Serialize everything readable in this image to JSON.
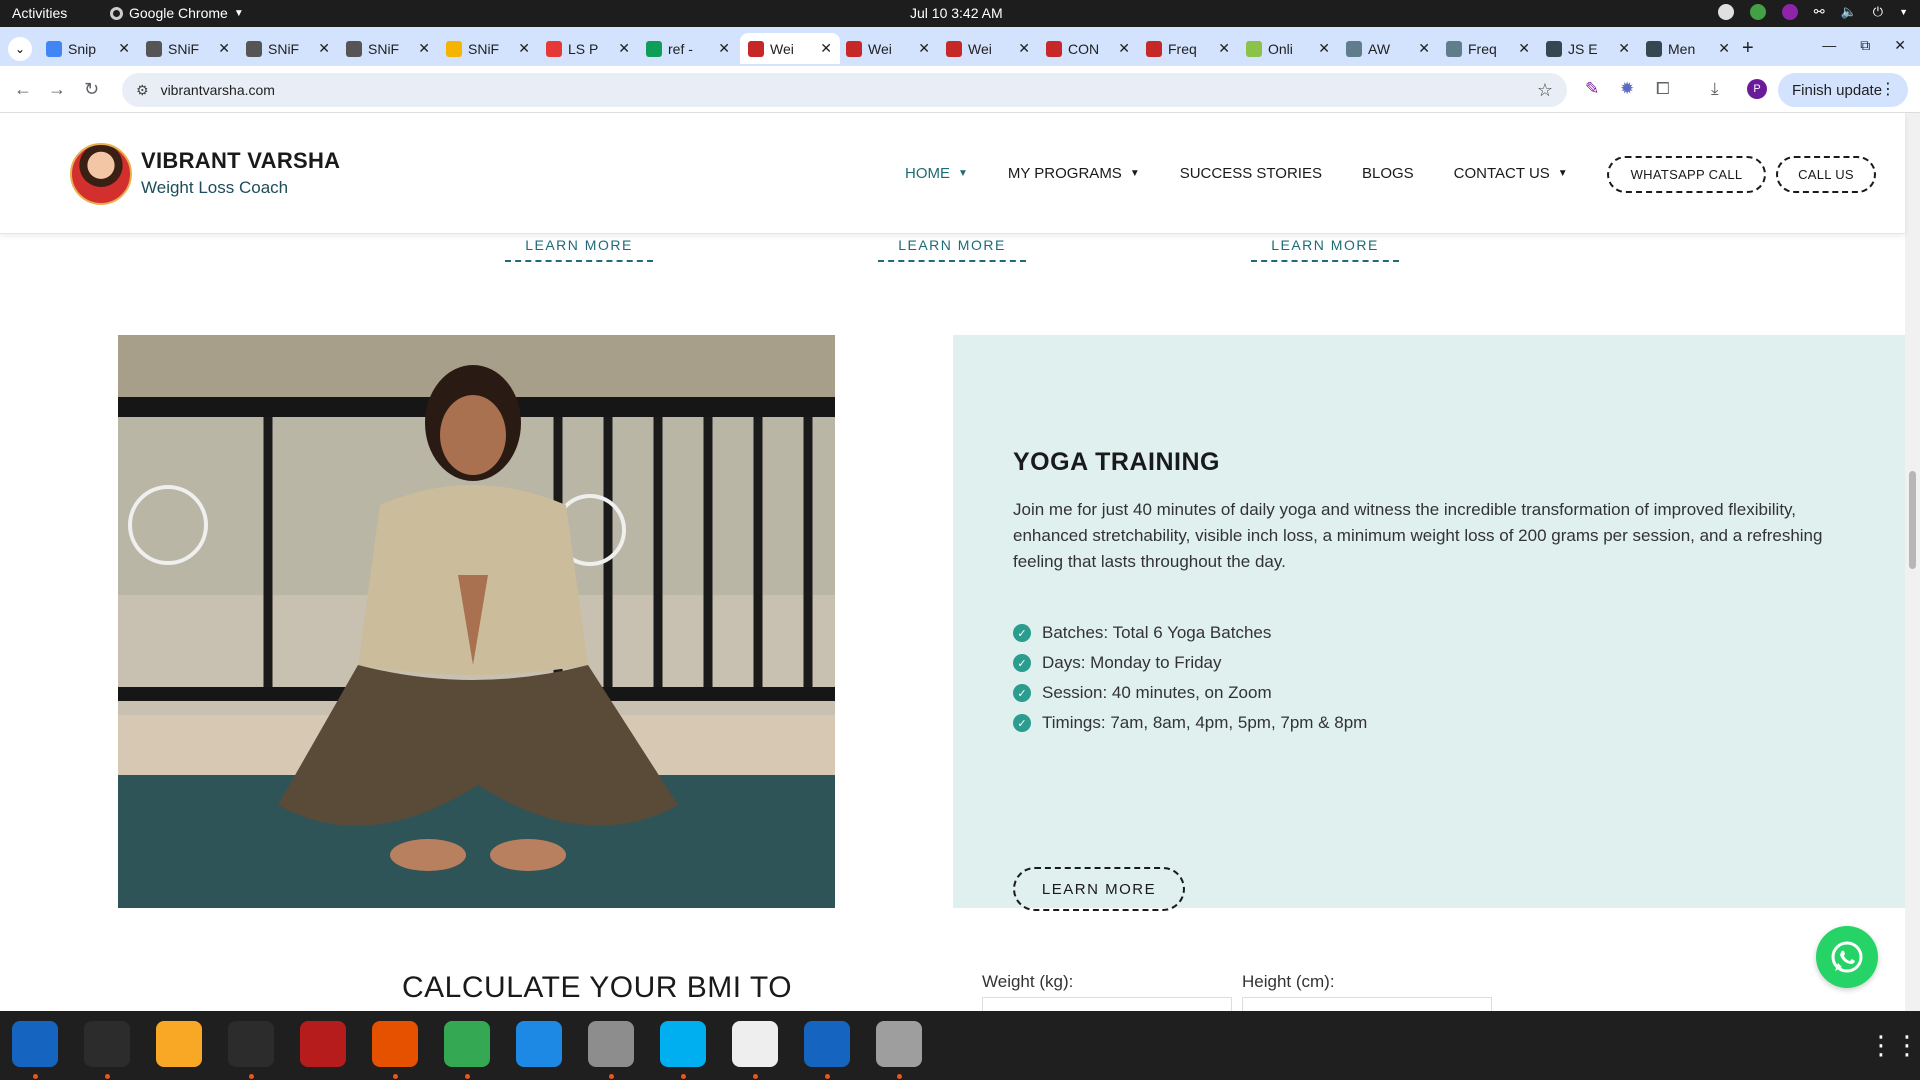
{
  "system": {
    "activities": "Activities",
    "app_name": "Google Chrome",
    "clock": "Jul 10  3:42 AM"
  },
  "tabs": [
    {
      "label": "Snip",
      "icon": "docs-icon",
      "color": "#4285f4"
    },
    {
      "label": "SNiF",
      "icon": "snif-icon",
      "color": "#555555"
    },
    {
      "label": "SNiF",
      "icon": "snif-icon",
      "color": "#555555"
    },
    {
      "label": "SNiF",
      "icon": "snif-icon",
      "color": "#555555"
    },
    {
      "label": "SNiF",
      "icon": "chrome-icon",
      "color": "#f4b400"
    },
    {
      "label": "LS P",
      "icon": "ls-icon",
      "color": "#e53935"
    },
    {
      "label": "ref -",
      "icon": "sheets-icon",
      "color": "#0f9d58"
    },
    {
      "label": "Wei",
      "icon": "vv-icon",
      "color": "#c62828"
    },
    {
      "label": "Wei",
      "icon": "vv-icon",
      "color": "#c62828"
    },
    {
      "label": "Wei",
      "icon": "vv-icon",
      "color": "#c62828"
    },
    {
      "label": "CON",
      "icon": "vv-icon",
      "color": "#c62828"
    },
    {
      "label": "Freq",
      "icon": "vv-icon",
      "color": "#c62828"
    },
    {
      "label": "Onli",
      "icon": "image-icon",
      "color": "#8bc34a"
    },
    {
      "label": "AW",
      "icon": "aw-icon",
      "color": "#607d8b"
    },
    {
      "label": "Freq",
      "icon": "freq-icon",
      "color": "#607d8b"
    },
    {
      "label": "JS E",
      "icon": "shield-icon",
      "color": "#37474f"
    },
    {
      "label": "Men",
      "icon": "shield-icon",
      "color": "#37474f"
    }
  ],
  "browser": {
    "url": "vibrantvarsha.com",
    "finish_update": "Finish update",
    "profile_initial": "P"
  },
  "site": {
    "brand_name": "VIBRANT VARSHA",
    "brand_tagline": "Weight Loss Coach",
    "nav": [
      {
        "label": "HOME",
        "has_caret": true
      },
      {
        "label": "MY PROGRAMS",
        "has_caret": true
      },
      {
        "label": "SUCCESS STORIES",
        "has_caret": false
      },
      {
        "label": "BLOGS",
        "has_caret": false
      },
      {
        "label": "CONTACT US",
        "has_caret": true
      }
    ],
    "whatsapp_call": "WHATSAPP CALL",
    "call_us": "CALL US",
    "learn_more": "LEARN MORE"
  },
  "yoga": {
    "title": "YOGA TRAINING",
    "description": "Join me for just 40 minutes of daily yoga and witness the incredible transformation of improved flexibility, enhanced stretchability, visible inch loss, a minimum weight loss of 200 grams per session, and a refreshing feeling that lasts throughout the day.",
    "features": [
      "Batches: Total 6 Yoga Batches",
      "Days: Monday to Friday",
      "Session: 40 minutes, on Zoom",
      "Timings: 7am, 8am, 4pm, 5pm, 7pm & 8pm"
    ],
    "button": "LEARN MORE"
  },
  "bmi": {
    "title": "CALCULATE YOUR BMI TO",
    "weight_label": "Weight (kg):",
    "height_label": "Height (cm):"
  },
  "dock": [
    {
      "name": "thunderbird-icon",
      "color": "#1565c0"
    },
    {
      "name": "terminal-icon",
      "color": "#2c2c2c"
    },
    {
      "name": "notes-icon",
      "color": "#f9a825"
    },
    {
      "name": "system-monitor-icon",
      "color": "#2c2c2c"
    },
    {
      "name": "filezilla-icon",
      "color": "#b71c1c"
    },
    {
      "name": "firefox-icon",
      "color": "#e65100"
    },
    {
      "name": "chrome-icon",
      "color": "#34a853"
    },
    {
      "name": "vscode-icon",
      "color": "#1e88e5"
    },
    {
      "name": "files-icon",
      "color": "#8d8d8d"
    },
    {
      "name": "skype-icon",
      "color": "#00aff0"
    },
    {
      "name": "text-editor-icon",
      "color": "#eeeeee"
    },
    {
      "name": "document-viewer-icon",
      "color": "#1565c0"
    },
    {
      "name": "disks-icon",
      "color": "#9e9e9e"
    }
  ],
  "colors": {
    "accent_teal": "#1d6b78",
    "panel_bg": "#dff0ee",
    "check_green": "#2a9d8f",
    "whatsapp_green": "#25d366",
    "chrome_tab_bg": "#d3e3fd"
  }
}
